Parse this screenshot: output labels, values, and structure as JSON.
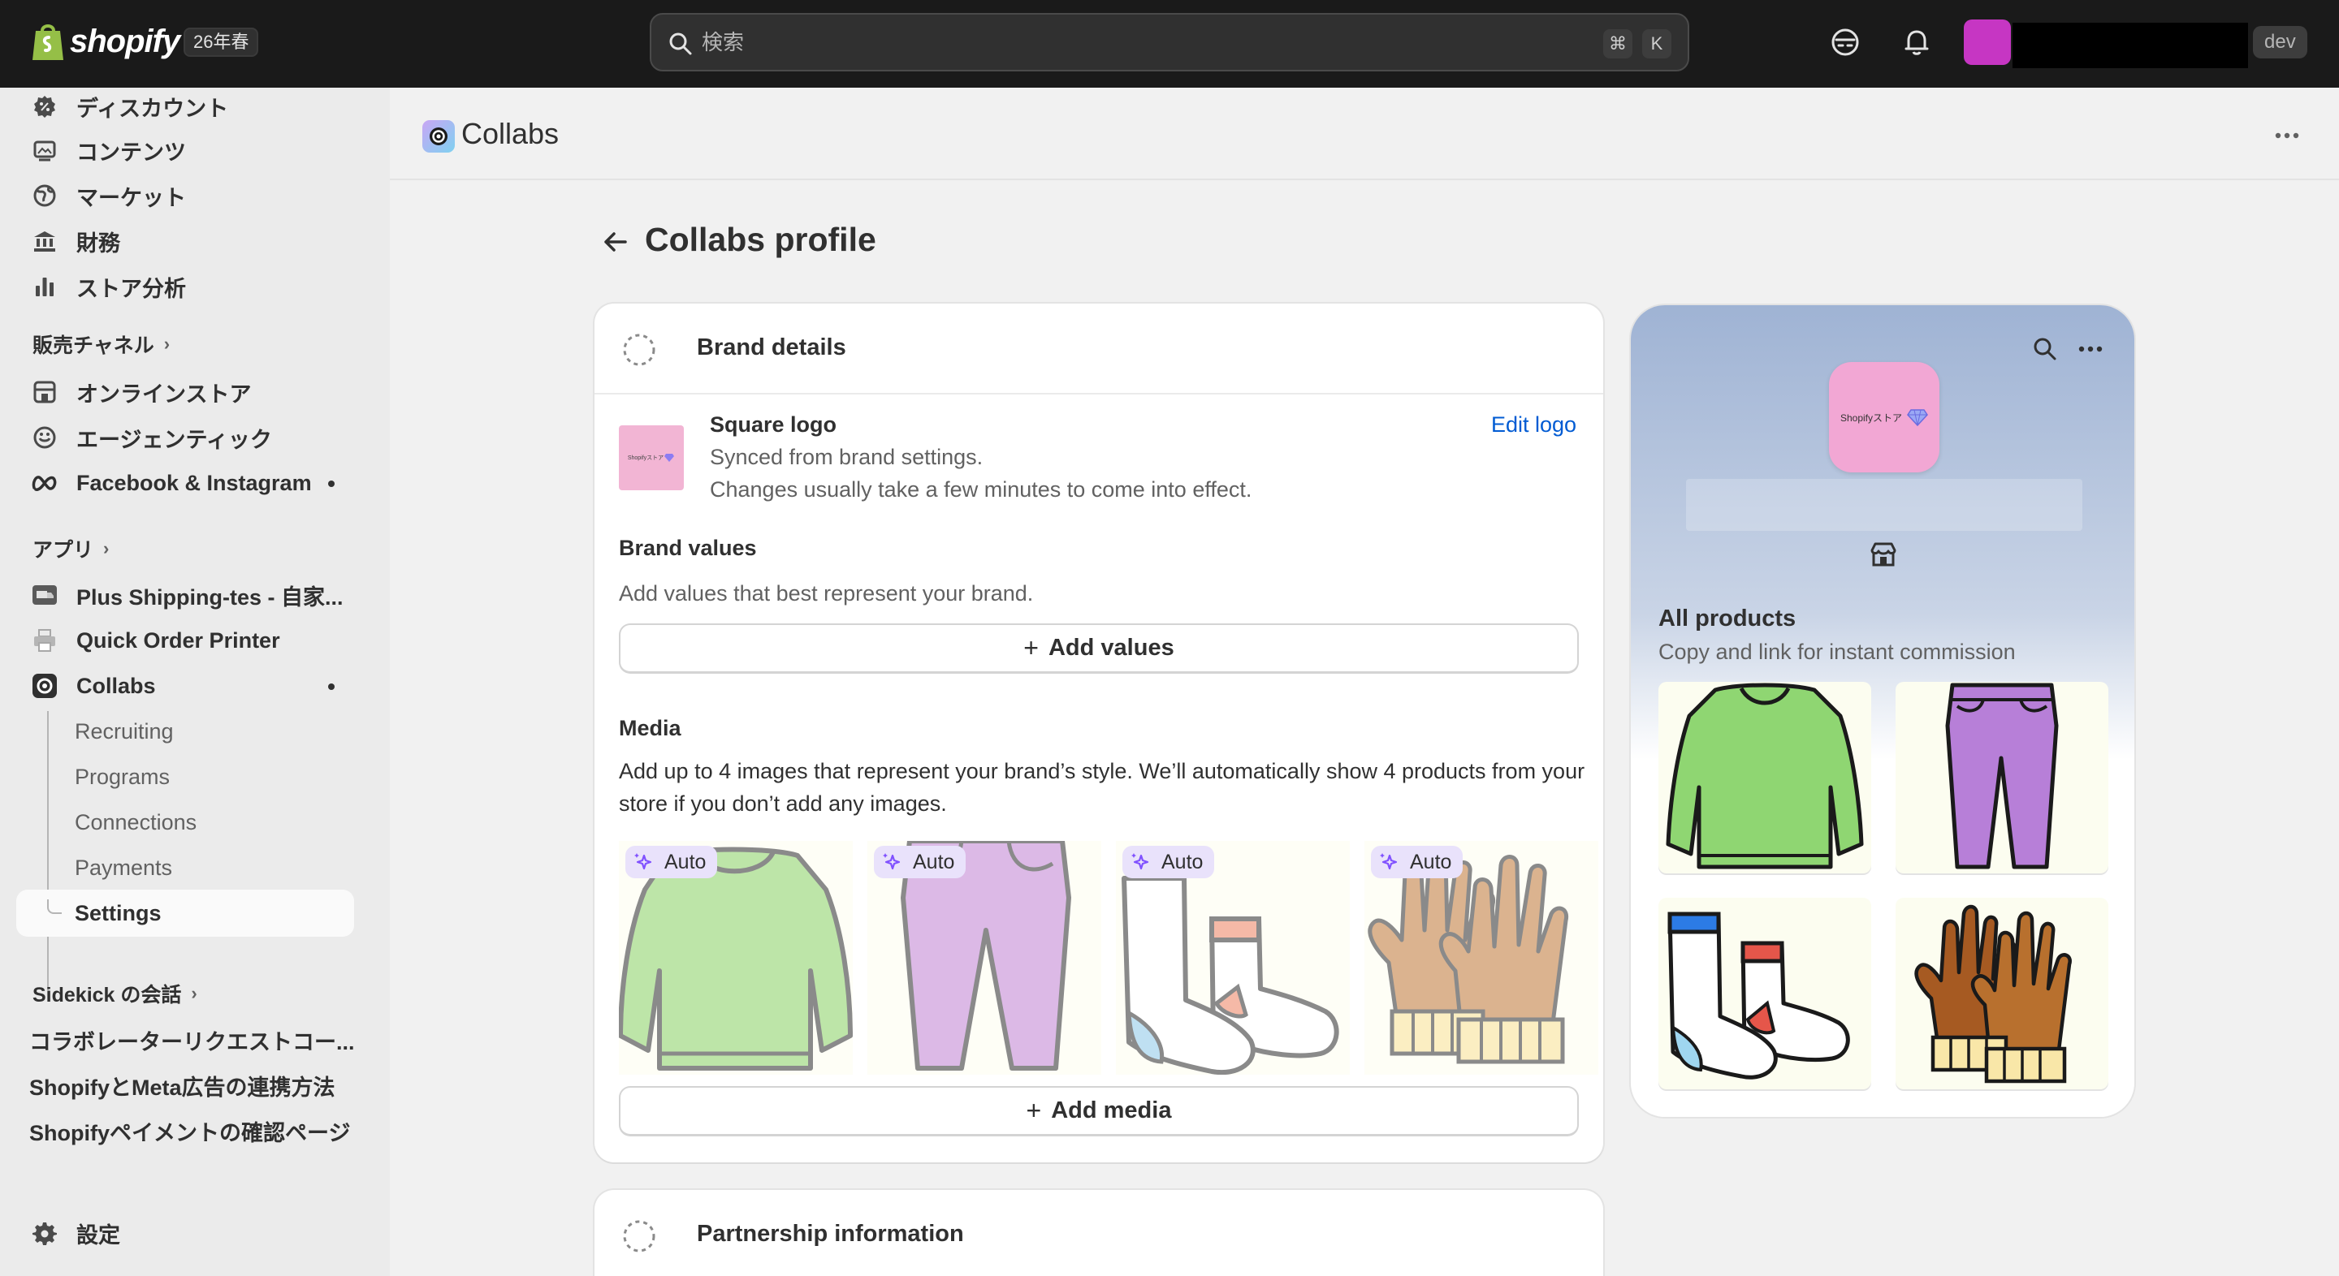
{
  "topbar": {
    "brand": "shopify",
    "edition_badge": "26年春",
    "search_placeholder": "検索",
    "shortcut_cmd": "⌘",
    "shortcut_key": "K",
    "dev_badge": "dev",
    "store_avatar_color": "#c636c3"
  },
  "sidebar": {
    "main_items": [
      {
        "label": "ディスカウント",
        "icon": "discount-icon"
      },
      {
        "label": "コンテンツ",
        "icon": "content-icon"
      },
      {
        "label": "マーケット",
        "icon": "globe-icon"
      },
      {
        "label": "財務",
        "icon": "bank-icon"
      },
      {
        "label": "ストア分析",
        "icon": "bar-chart-icon"
      }
    ],
    "sales_channels_label": "販売チャネル",
    "channels": [
      {
        "label": "オンラインストア",
        "icon": "store-icon"
      },
      {
        "label": "エージェンティック",
        "icon": "agentic-icon"
      },
      {
        "label": "Facebook & Instagram",
        "icon": "meta-icon"
      }
    ],
    "apps_label": "アプリ",
    "apps": [
      {
        "label": "Plus Shipping-tes - 自家...",
        "icon": "shipping-app-icon"
      },
      {
        "label": "Quick Order Printer",
        "icon": "printer-icon"
      },
      {
        "label": "Collabs",
        "icon": "collabs-icon"
      }
    ],
    "collabs_sub": [
      "Recruiting",
      "Programs",
      "Connections",
      "Payments"
    ],
    "collabs_active": "Settings",
    "sidekick_label": "Sidekick の会話",
    "conversations": [
      "コラボレーターリクエストコー...",
      "ShopifyとMeta広告の連携方法",
      "Shopifyペイメントの確認ページ"
    ],
    "settings_label": "設定"
  },
  "header": {
    "app_title": "Collabs"
  },
  "page": {
    "title": "Collabs profile"
  },
  "brand_card": {
    "title": "Brand details",
    "square_logo_label": "Square logo",
    "square_logo_line1": "Synced from brand settings.",
    "square_logo_line2": "Changes usually take a few minutes to come into effect.",
    "edit_logo": "Edit logo",
    "logo_thumb_text": "Shopifyストア",
    "brand_values_label": "Brand values",
    "brand_values_help": "Add values that best represent your brand.",
    "add_values": "Add values",
    "media_label": "Media",
    "media_help": "Add up to 4 images that represent your brand’s style. We’ll automatically show 4 products from your store if you don’t add any images.",
    "media_items": [
      {
        "badge": "Auto",
        "item": "sweater"
      },
      {
        "badge": "Auto",
        "item": "pants"
      },
      {
        "badge": "Auto",
        "item": "socks"
      },
      {
        "badge": "Auto",
        "item": "gloves"
      }
    ],
    "add_media": "Add media"
  },
  "partner_card": {
    "title": "Partnership information"
  },
  "preview": {
    "logo_text": "Shopifyストア",
    "section_title": "All products",
    "section_sub": "Copy and link for instant commission",
    "products": [
      "sweater",
      "pants",
      "socks",
      "gloves"
    ]
  }
}
